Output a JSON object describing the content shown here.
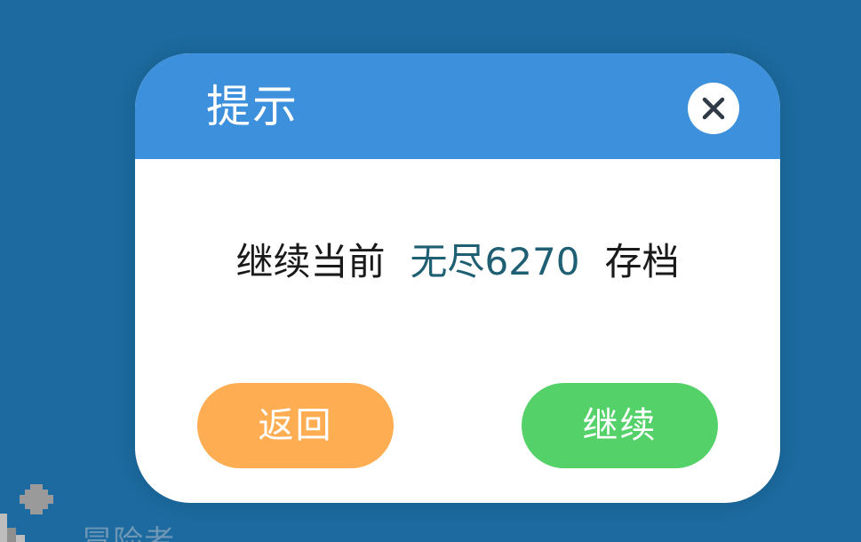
{
  "background": {
    "color": "#1c6a9f",
    "partial_label": "冒险者"
  },
  "dialog": {
    "title": "提示",
    "close_icon": "close-icon",
    "message": {
      "prefix": "继续当前",
      "save_name": "无尽6270",
      "suffix": "存档"
    },
    "buttons": {
      "back_label": "返回",
      "continue_label": "继续"
    },
    "colors": {
      "header": "#3d90db",
      "back_button": "#ffad52",
      "continue_button": "#55d169",
      "save_name": "#1e5f73"
    }
  }
}
